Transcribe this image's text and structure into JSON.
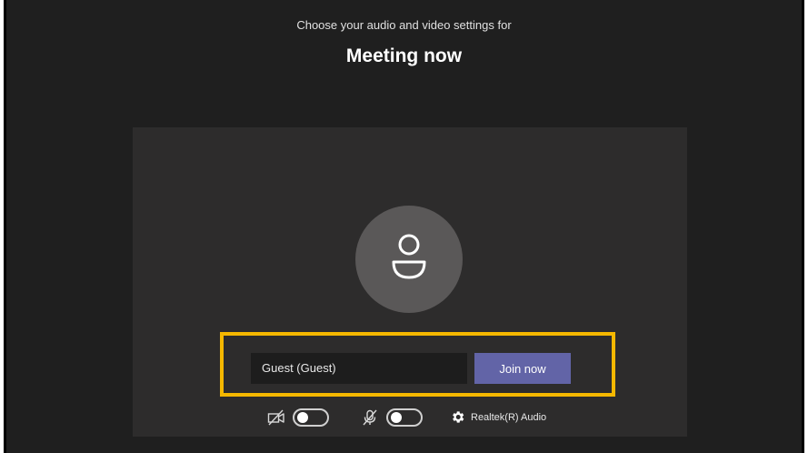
{
  "header": {
    "subtitle": "Choose your audio and video settings for",
    "title": "Meeting now"
  },
  "prejoin": {
    "avatar_icon": "person-icon",
    "name_input_value": "Guest (Guest)",
    "join_label": "Join now",
    "join_color": "#6264a7",
    "highlight_color": "#f5b800"
  },
  "controls": {
    "camera_icon": "camera-off-icon",
    "camera_enabled": false,
    "mic_icon": "mic-off-icon",
    "mic_enabled": false,
    "device_icon": "gear-icon",
    "device_label": "Realtek(R) Audio"
  }
}
